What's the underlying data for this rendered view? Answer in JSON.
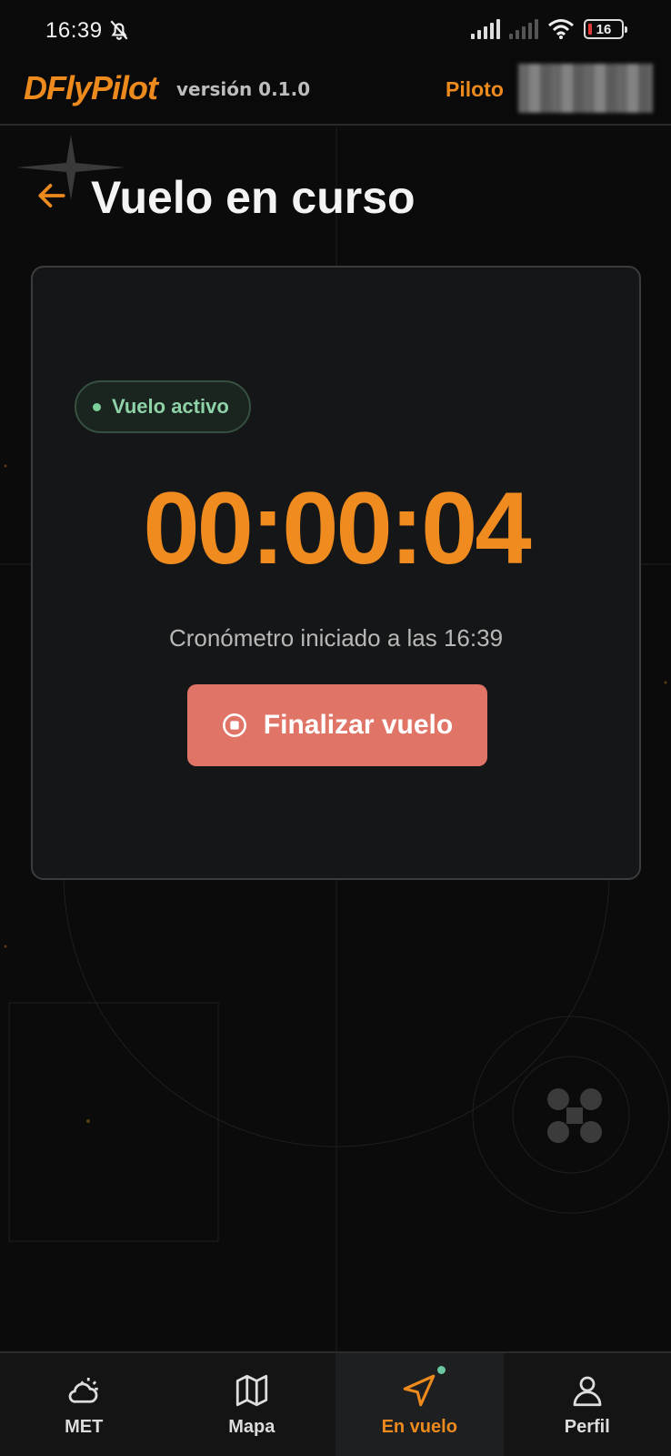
{
  "status_bar": {
    "time": "16:39",
    "battery": "16"
  },
  "header": {
    "brand": "DFlyPilot",
    "version": "versión 0.1.0",
    "pilot_label": "Piloto"
  },
  "page": {
    "title": "Vuelo en curso"
  },
  "flight": {
    "status_badge": "Vuelo activo",
    "timer": "00:00:04",
    "started_text": "Cronómetro iniciado a las 16:39",
    "end_button_label": "Finalizar vuelo"
  },
  "nav": {
    "items": [
      {
        "label": "MET",
        "icon": "weather-icon"
      },
      {
        "label": "Mapa",
        "icon": "map-icon"
      },
      {
        "label": "En vuelo",
        "icon": "navigation-arrow-icon",
        "active": true
      },
      {
        "label": "Perfil",
        "icon": "user-icon"
      }
    ]
  },
  "colors": {
    "accent": "#ec8a1e",
    "danger": "#e07466",
    "success": "#8fd2a8",
    "background": "#0b0b0c"
  }
}
